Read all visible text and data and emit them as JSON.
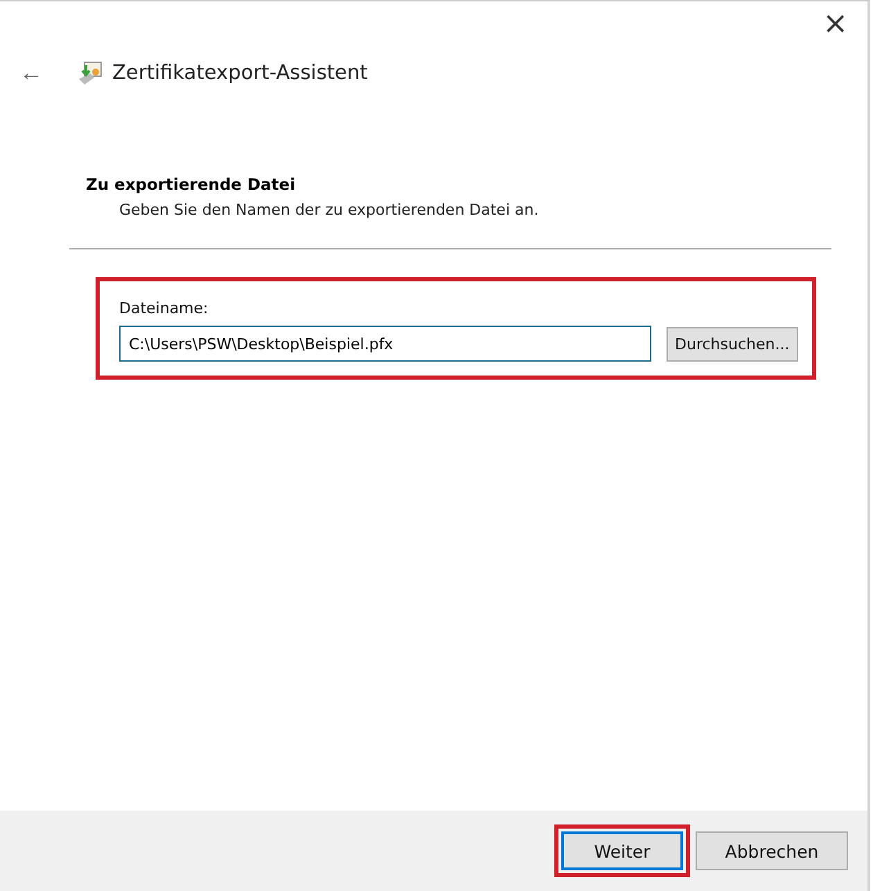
{
  "window": {
    "title": "Zertifikatexport-Assistent",
    "close": "×",
    "back": "←"
  },
  "page": {
    "heading": "Zu exportierende Datei",
    "description": "Geben Sie den Namen der zu exportierenden Datei an."
  },
  "file": {
    "label": "Dateiname:",
    "value": "C:\\Users\\PSW\\Desktop\\Beispiel.pfx",
    "browse": "Durchsuchen...",
    "highlighted": true
  },
  "buttons": [
    {
      "label": "Weiter",
      "highlighted": true,
      "default": true
    },
    {
      "label": "Abbrechen",
      "highlighted": false,
      "default": false
    }
  ]
}
